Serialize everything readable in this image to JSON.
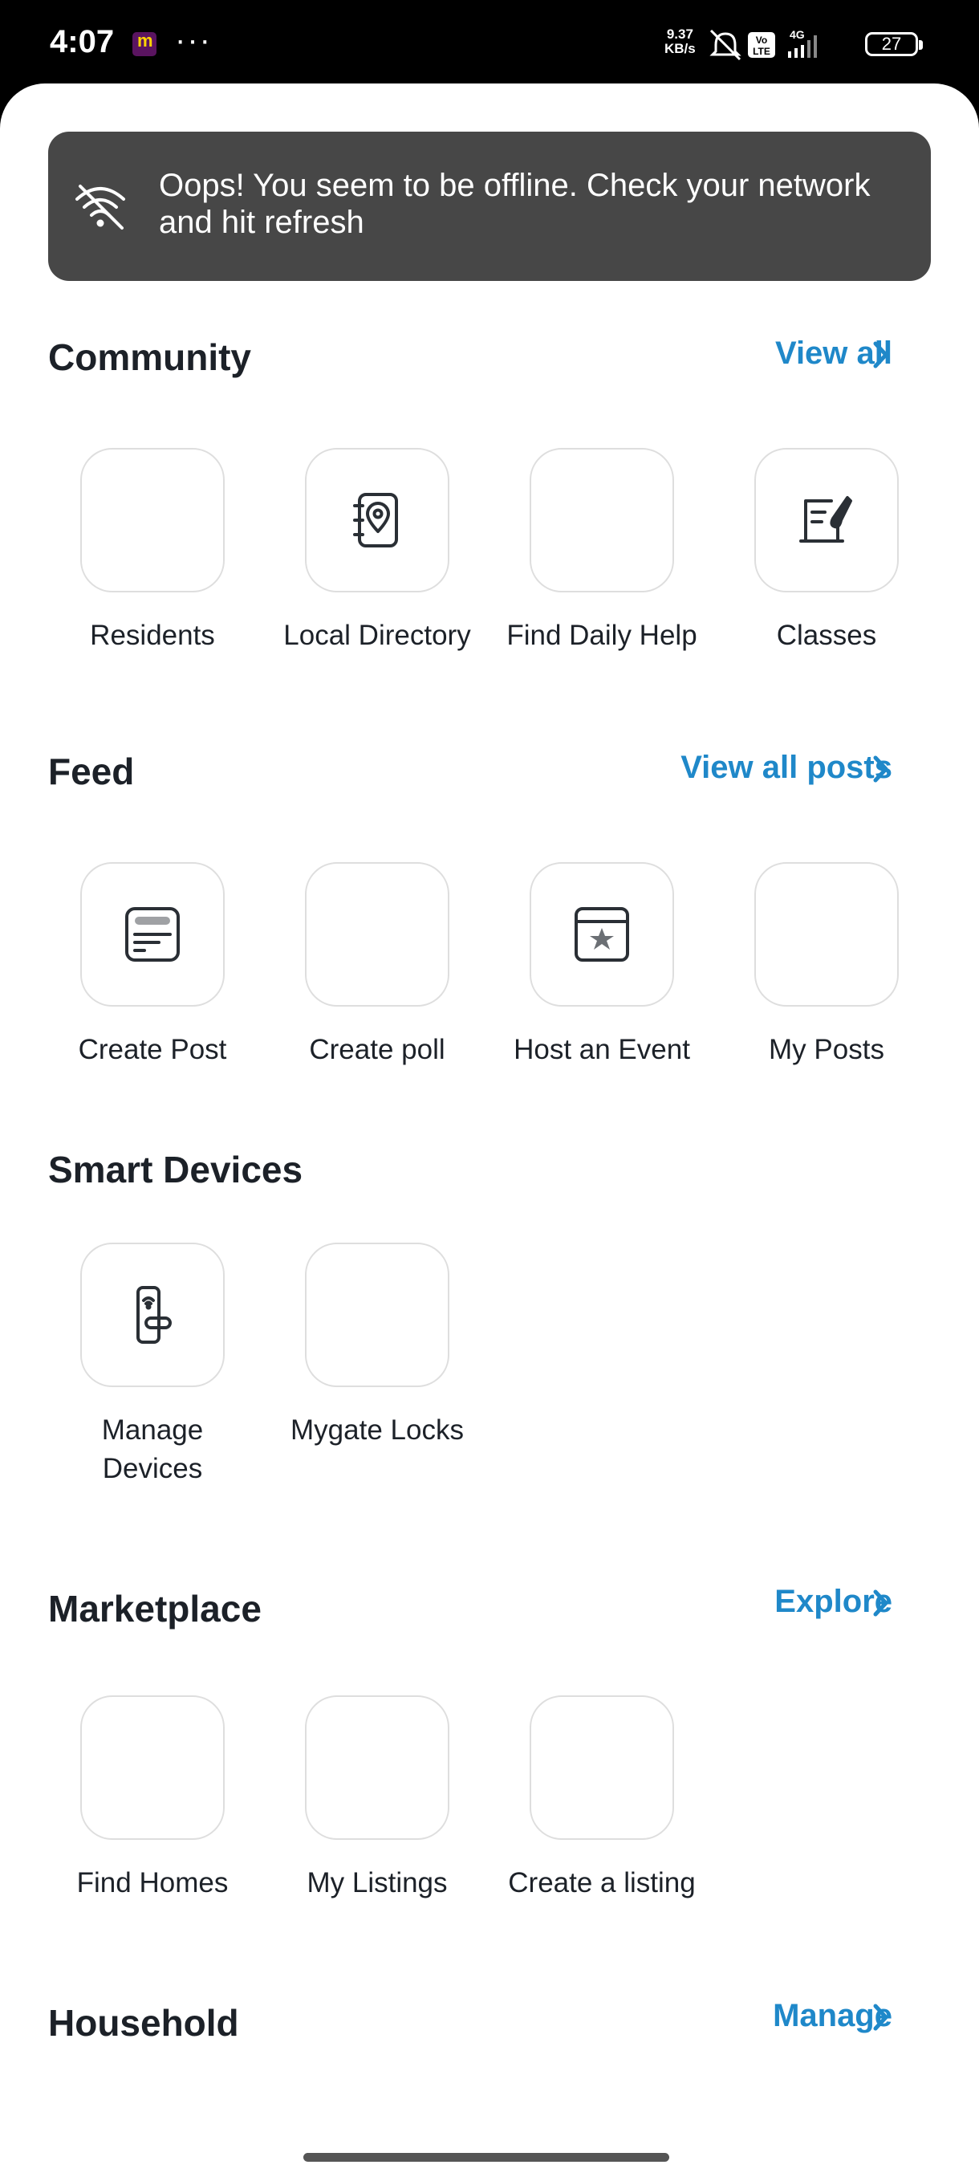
{
  "status_bar": {
    "time": "4:07",
    "dots": "···",
    "speed_top": "9.37",
    "speed_bottom": "KB/s",
    "network": "4G",
    "volte": "Vo LTE",
    "battery": "27"
  },
  "toast": {
    "icon": "wifi-off-icon",
    "message": "Oops! You seem to be offline. Check your network and hit refresh"
  },
  "community": {
    "title": "Community",
    "link": "View all",
    "tiles": [
      {
        "label": "Residents",
        "icon": ""
      },
      {
        "label": "Local Directory",
        "icon": "map-pin-book-icon"
      },
      {
        "label": "Find Daily Help",
        "icon": ""
      },
      {
        "label": "Classes",
        "icon": "book-brush-icon"
      }
    ]
  },
  "feed": {
    "title": "Feed",
    "link": "View all posts",
    "tiles": [
      {
        "label": "Create Post",
        "icon": "document-text-icon"
      },
      {
        "label": "Create poll",
        "icon": ""
      },
      {
        "label": "Host an Event",
        "icon": "calendar-star-icon"
      },
      {
        "label": "My Posts",
        "icon": ""
      }
    ]
  },
  "smart_devices": {
    "title": "Smart Devices",
    "tiles": [
      {
        "label": "Manage Devices",
        "icon": "smart-lock-icon"
      },
      {
        "label": "Mygate Locks",
        "icon": ""
      }
    ]
  },
  "marketplace": {
    "title": "Marketplace",
    "link": "Explore",
    "tiles": [
      {
        "label": "Find Homes",
        "icon": ""
      },
      {
        "label": "My Listings",
        "icon": ""
      },
      {
        "label": "Create a listing",
        "icon": ""
      }
    ]
  },
  "household": {
    "title": "Household",
    "link": "Manage"
  },
  "colors": {
    "accent": "#1f88c9",
    "toast_bg": "#474747",
    "text": "#1c2128",
    "tile_border": "#dedede"
  }
}
